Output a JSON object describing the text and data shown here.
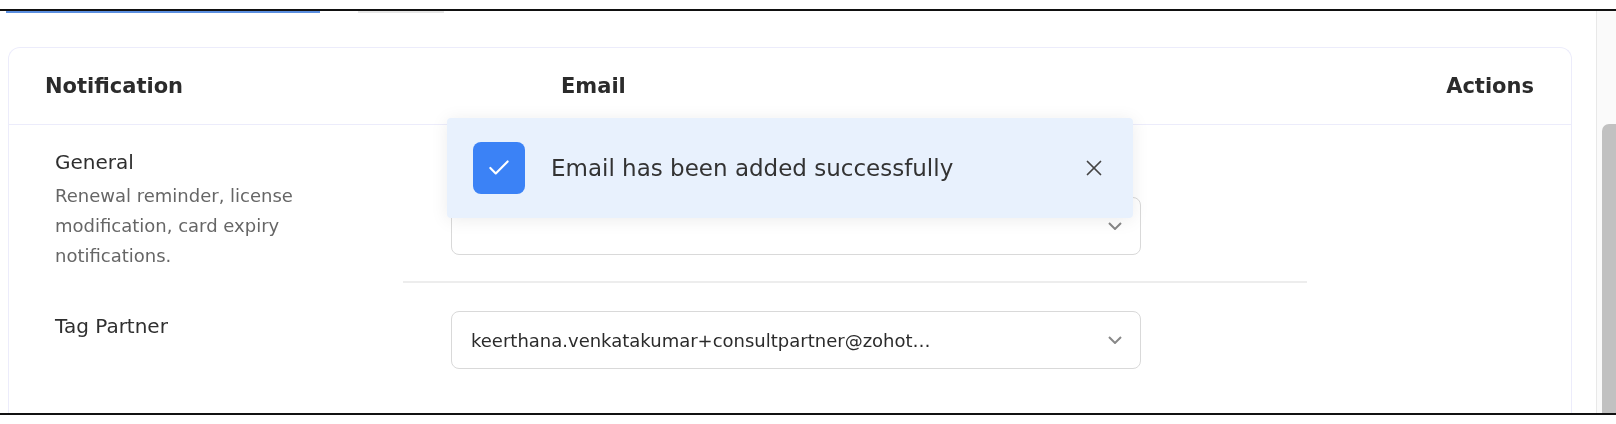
{
  "tab_indicators": [
    {
      "selected": true
    },
    {
      "selected": false
    }
  ],
  "table": {
    "columns": [
      "Notification",
      "Email",
      "Actions"
    ],
    "rows": [
      {
        "name": "General",
        "description": "Renewal reminder, license modification, card expiry notifications."
      },
      {
        "name": "Tag Partner",
        "email": "keerthana.venkatakumar+consultpartner@zohot…"
      }
    ]
  },
  "toast": {
    "message": "Email has been added successfully"
  }
}
